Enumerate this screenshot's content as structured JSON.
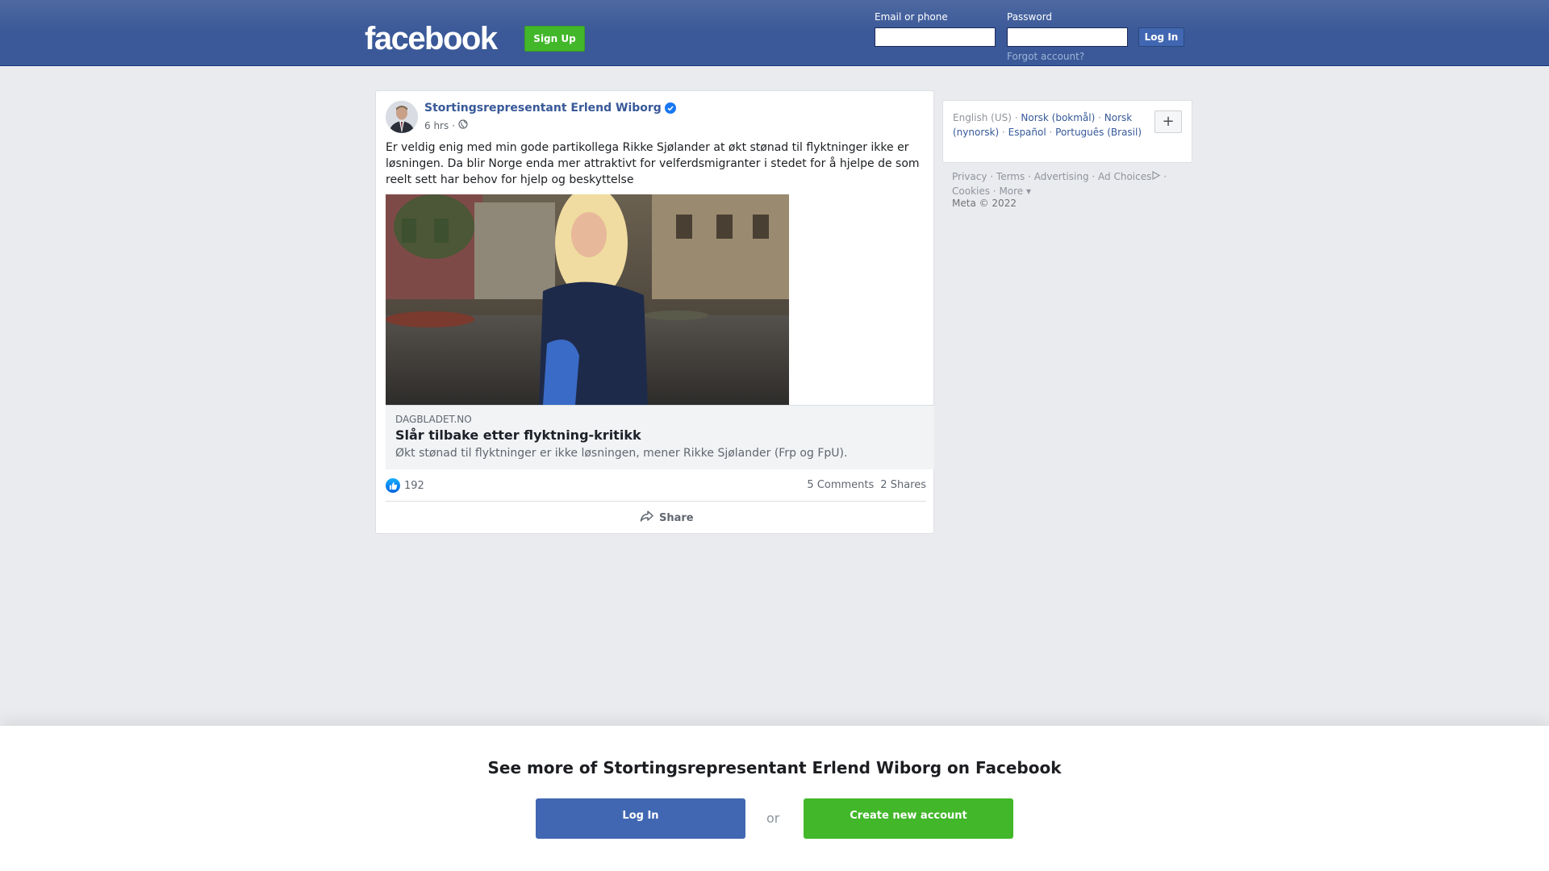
{
  "header": {
    "logo": "facebook",
    "signup_label": "Sign Up",
    "email_label": "Email or phone",
    "password_label": "Password",
    "login_label": "Log In",
    "forgot_label": "Forgot account?"
  },
  "post": {
    "author": "Stortingsrepresentant Erlend Wiborg",
    "time": "6 hrs",
    "separator": "·",
    "audience_icon": "globe-icon",
    "text": "Er veldig enig med min gode partikollega Rikke Sjølander at økt stønad til flyktninger ikke er løsningen. Da blir Norge enda mer attraktivt for velferdsmigranter i stedet for å hjelpe de som reelt sett har behov for hjelp og beskyttelse",
    "link": {
      "domain": "DAGBLADET.NO",
      "title": "Slår tilbake etter flyktning-kritikk",
      "description": "Økt stønad til flyktninger er ikke løsningen, mener Rikke Sjølander (Frp og FpU)."
    },
    "likes": "192",
    "comments": "5 Comments",
    "shares": "2 Shares",
    "share_label": "Share"
  },
  "sidebar": {
    "languages": {
      "current": "English (US)",
      "options": [
        "Norsk (bokmål)",
        "Norsk (nynorsk)",
        "Español",
        "Português (Brasil)"
      ],
      "add_label": "+"
    },
    "footer_links": [
      "Privacy",
      "Terms",
      "Advertising",
      "Ad Choices",
      "Cookies",
      "More"
    ],
    "copyright": "Meta © 2022"
  },
  "banner": {
    "title": "See more of Stortingsrepresentant Erlend Wiborg on Facebook",
    "login_label": "Log In",
    "or_label": "or",
    "create_label": "Create new account"
  },
  "colors": {
    "brand_blue": "#3b5998",
    "link_blue": "#385898",
    "green": "#42b72a",
    "background": "#e9ebee"
  }
}
